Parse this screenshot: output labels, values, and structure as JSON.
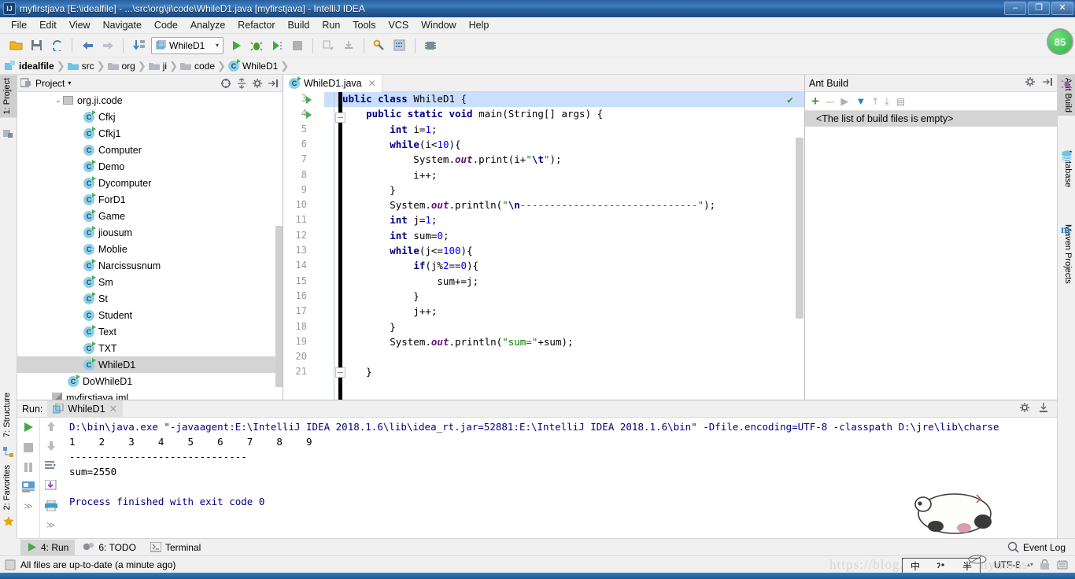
{
  "window": {
    "title": "myfirstjava [E:\\idealfile] - ...\\src\\org\\ji\\code\\WhileD1.java [myfirstjava] - IntelliJ IDEA",
    "app_icon": "intellij-logo-icon",
    "minimize": "–",
    "maximize": "❐",
    "close": "✕",
    "notification_badge": "85"
  },
  "menubar": {
    "items": [
      {
        "label": "File"
      },
      {
        "label": "Edit"
      },
      {
        "label": "View"
      },
      {
        "label": "Navigate"
      },
      {
        "label": "Code"
      },
      {
        "label": "Analyze"
      },
      {
        "label": "Refactor"
      },
      {
        "label": "Build"
      },
      {
        "label": "Run"
      },
      {
        "label": "Tools"
      },
      {
        "label": "VCS"
      },
      {
        "label": "Window"
      },
      {
        "label": "Help"
      }
    ]
  },
  "toolbar": {
    "icons": [
      {
        "name": "open-folder-icon"
      },
      {
        "name": "save-all-icon"
      },
      {
        "name": "sync-refresh-icon"
      },
      {
        "name": "back-arrow-icon"
      },
      {
        "name": "forward-arrow-icon"
      },
      {
        "name": "compile-icon"
      }
    ],
    "run_config": "WhileD1",
    "run_config_chevron": "▾",
    "right_icons": [
      {
        "name": "run-icon"
      },
      {
        "name": "debug-icon"
      },
      {
        "name": "run-coverage-icon"
      },
      {
        "name": "stop-icon"
      },
      {
        "name": "attach-profiler-icon"
      },
      {
        "name": "attach-debugger-icon"
      },
      {
        "name": "settings-wrench-icon"
      },
      {
        "name": "project-structure-icon"
      },
      {
        "name": "sdk-manager-icon"
      }
    ]
  },
  "breadcrumb": {
    "items": [
      {
        "label": "idealfile",
        "icon": "module-icon"
      },
      {
        "label": "src",
        "icon": "source-folder-icon"
      },
      {
        "label": "org",
        "icon": "folder-icon"
      },
      {
        "label": "ji",
        "icon": "folder-icon"
      },
      {
        "label": "code",
        "icon": "folder-icon"
      },
      {
        "label": "WhileD1",
        "icon": "class-icon"
      }
    ],
    "separator": "❯"
  },
  "left_strip": {
    "tabs": [
      {
        "label": "1: Project",
        "active": true,
        "icon": "project-icon"
      },
      {
        "label": "7: Structure",
        "active": false,
        "icon": "structure-icon"
      },
      {
        "label": "2: Favorites",
        "active": false,
        "icon": "star-icon"
      }
    ]
  },
  "right_strip": {
    "tabs": [
      {
        "label": "Ant Build",
        "active": true,
        "icon": "ant-icon"
      },
      {
        "label": "Database",
        "active": false,
        "icon": "database-icon"
      },
      {
        "label": "Maven Projects",
        "active": false,
        "icon": "maven-icon"
      }
    ]
  },
  "project_panel": {
    "title": "Project",
    "title_chevron": "▾",
    "header_icons": [
      {
        "name": "collapse-target-icon"
      },
      {
        "name": "expand-collapse-icon"
      },
      {
        "name": "gear-icon"
      },
      {
        "name": "hide-panel-icon"
      }
    ],
    "tree": [
      {
        "label": "org.ji.code",
        "icon": "package-icon",
        "indent": 0,
        "expanded": true,
        "selected": false
      },
      {
        "label": "Cfkj",
        "icon": "class-runnable-icon",
        "indent": 1,
        "selected": false
      },
      {
        "label": "Cfkj1",
        "icon": "class-runnable-icon",
        "indent": 1,
        "selected": false
      },
      {
        "label": "Computer",
        "icon": "class-icon",
        "indent": 1,
        "selected": false
      },
      {
        "label": "Demo",
        "icon": "class-runnable-icon",
        "indent": 1,
        "selected": false
      },
      {
        "label": "Dycomputer",
        "icon": "class-runnable-icon",
        "indent": 1,
        "selected": false
      },
      {
        "label": "ForD1",
        "icon": "class-runnable-icon",
        "indent": 1,
        "selected": false
      },
      {
        "label": "Game",
        "icon": "class-runnable-icon",
        "indent": 1,
        "selected": false
      },
      {
        "label": "jiousum",
        "icon": "class-runnable-icon",
        "indent": 1,
        "selected": false
      },
      {
        "label": "Moblie",
        "icon": "class-icon",
        "indent": 1,
        "selected": false
      },
      {
        "label": "Narcissusnum",
        "icon": "class-runnable-icon",
        "indent": 1,
        "selected": false
      },
      {
        "label": "Sm",
        "icon": "class-runnable-icon",
        "indent": 1,
        "selected": false
      },
      {
        "label": "St",
        "icon": "class-runnable-icon",
        "indent": 1,
        "selected": false
      },
      {
        "label": "Student",
        "icon": "class-icon",
        "indent": 1,
        "selected": false
      },
      {
        "label": "Text",
        "icon": "class-runnable-icon",
        "indent": 1,
        "selected": false
      },
      {
        "label": "TXT",
        "icon": "class-runnable-icon",
        "indent": 1,
        "selected": false
      },
      {
        "label": "WhileD1",
        "icon": "class-runnable-icon",
        "indent": 1,
        "selected": true
      },
      {
        "label": "DoWhileD1",
        "icon": "class-runnable-icon",
        "indent": 0,
        "selected": false
      },
      {
        "label": "myfirstjava.iml",
        "icon": "iml-file-icon",
        "indent": 0,
        "selected": false
      }
    ]
  },
  "editor": {
    "tab": {
      "label": "WhileD1.java",
      "icon": "class-icon",
      "close": "✕"
    },
    "inspection_status": "✔",
    "first_line_number": 3,
    "lines": [
      {
        "n": 3,
        "runnable": true,
        "fold": false,
        "highlight": true,
        "tokens": [
          {
            "t": "ublic ",
            "c": "kw"
          },
          {
            "t": "class ",
            "c": "kw"
          },
          {
            "t": "WhileD1 {",
            "c": ""
          }
        ]
      },
      {
        "n": 4,
        "runnable": true,
        "fold": true,
        "highlight": false,
        "tokens": [
          {
            "t": "    ",
            "c": ""
          },
          {
            "t": "public static void ",
            "c": "kw"
          },
          {
            "t": "main(String[] args) {",
            "c": ""
          }
        ]
      },
      {
        "n": 5,
        "runnable": false,
        "fold": false,
        "highlight": false,
        "tokens": [
          {
            "t": "        ",
            "c": ""
          },
          {
            "t": "int ",
            "c": "kw"
          },
          {
            "t": "i=",
            "c": ""
          },
          {
            "t": "1",
            "c": "num"
          },
          {
            "t": ";",
            "c": ""
          }
        ]
      },
      {
        "n": 6,
        "runnable": false,
        "fold": false,
        "highlight": false,
        "tokens": [
          {
            "t": "        ",
            "c": ""
          },
          {
            "t": "while",
            "c": "kw"
          },
          {
            "t": "(i<",
            "c": ""
          },
          {
            "t": "10",
            "c": "num"
          },
          {
            "t": "){",
            "c": ""
          }
        ]
      },
      {
        "n": 7,
        "runnable": false,
        "fold": false,
        "highlight": false,
        "tokens": [
          {
            "t": "            System.",
            "c": ""
          },
          {
            "t": "out",
            "c": "stc"
          },
          {
            "t": ".print(i+",
            "c": ""
          },
          {
            "t": "\"",
            "c": "str"
          },
          {
            "t": "\\t",
            "c": "esc"
          },
          {
            "t": "\"",
            "c": "str"
          },
          {
            "t": ");",
            "c": ""
          }
        ]
      },
      {
        "n": 8,
        "runnable": false,
        "fold": false,
        "highlight": false,
        "tokens": [
          {
            "t": "            i++;",
            "c": ""
          }
        ]
      },
      {
        "n": 9,
        "runnable": false,
        "fold": false,
        "highlight": false,
        "tokens": [
          {
            "t": "        }",
            "c": ""
          }
        ]
      },
      {
        "n": 10,
        "runnable": false,
        "fold": false,
        "highlight": false,
        "tokens": [
          {
            "t": "        System.",
            "c": ""
          },
          {
            "t": "out",
            "c": "stc"
          },
          {
            "t": ".println(",
            "c": ""
          },
          {
            "t": "\"",
            "c": "str"
          },
          {
            "t": "\\n",
            "c": "esc"
          },
          {
            "t": "------------------------------",
            "c": "str"
          },
          {
            "t": "\"",
            "c": "str"
          },
          {
            "t": ");",
            "c": ""
          }
        ]
      },
      {
        "n": 11,
        "runnable": false,
        "fold": false,
        "highlight": false,
        "tokens": [
          {
            "t": "        ",
            "c": ""
          },
          {
            "t": "int ",
            "c": "kw"
          },
          {
            "t": "j=",
            "c": ""
          },
          {
            "t": "1",
            "c": "num"
          },
          {
            "t": ";",
            "c": ""
          }
        ]
      },
      {
        "n": 12,
        "runnable": false,
        "fold": false,
        "highlight": false,
        "tokens": [
          {
            "t": "        ",
            "c": ""
          },
          {
            "t": "int ",
            "c": "kw"
          },
          {
            "t": "sum=",
            "c": ""
          },
          {
            "t": "0",
            "c": "num"
          },
          {
            "t": ";",
            "c": ""
          }
        ]
      },
      {
        "n": 13,
        "runnable": false,
        "fold": false,
        "highlight": false,
        "tokens": [
          {
            "t": "        ",
            "c": ""
          },
          {
            "t": "while",
            "c": "kw"
          },
          {
            "t": "(j<=",
            "c": ""
          },
          {
            "t": "100",
            "c": "num"
          },
          {
            "t": "){",
            "c": ""
          }
        ]
      },
      {
        "n": 14,
        "runnable": false,
        "fold": false,
        "highlight": false,
        "tokens": [
          {
            "t": "            ",
            "c": ""
          },
          {
            "t": "if",
            "c": "kw"
          },
          {
            "t": "(j%",
            "c": ""
          },
          {
            "t": "2",
            "c": "num"
          },
          {
            "t": "==",
            "c": ""
          },
          {
            "t": "0",
            "c": "num"
          },
          {
            "t": "){",
            "c": ""
          }
        ]
      },
      {
        "n": 15,
        "runnable": false,
        "fold": false,
        "highlight": false,
        "tokens": [
          {
            "t": "                sum+=j;",
            "c": ""
          }
        ]
      },
      {
        "n": 16,
        "runnable": false,
        "fold": false,
        "highlight": false,
        "tokens": [
          {
            "t": "            }",
            "c": ""
          }
        ]
      },
      {
        "n": 17,
        "runnable": false,
        "fold": false,
        "highlight": false,
        "tokens": [
          {
            "t": "            j++;",
            "c": ""
          }
        ]
      },
      {
        "n": 18,
        "runnable": false,
        "fold": false,
        "highlight": false,
        "tokens": [
          {
            "t": "        }",
            "c": ""
          }
        ]
      },
      {
        "n": 19,
        "runnable": false,
        "fold": false,
        "highlight": false,
        "tokens": [
          {
            "t": "        System.",
            "c": ""
          },
          {
            "t": "out",
            "c": "stc"
          },
          {
            "t": ".println(",
            "c": ""
          },
          {
            "t": "\"sum=\"",
            "c": "str"
          },
          {
            "t": "+sum);",
            "c": ""
          }
        ]
      },
      {
        "n": 20,
        "runnable": false,
        "fold": false,
        "highlight": false,
        "tokens": [
          {
            "t": "",
            "c": ""
          }
        ]
      },
      {
        "n": 21,
        "runnable": false,
        "fold": true,
        "highlight": false,
        "tokens": [
          {
            "t": "    }",
            "c": ""
          }
        ]
      }
    ]
  },
  "ant_panel": {
    "title": "Ant Build",
    "empty_message": "<The list of build files is empty>",
    "toolbar_icons": [
      {
        "name": "add-icon",
        "glyph": "+"
      },
      {
        "name": "remove-icon",
        "glyph": "–"
      },
      {
        "name": "run-build-icon",
        "glyph": "▶"
      },
      {
        "name": "filter-icon",
        "glyph": "▼"
      },
      {
        "name": "expand-all-icon",
        "glyph": "⤒"
      },
      {
        "name": "collapse-all-icon",
        "glyph": "⤓"
      },
      {
        "name": "properties-icon",
        "glyph": "▤"
      }
    ],
    "header_icons": [
      {
        "name": "gear-icon"
      },
      {
        "name": "hide-panel-icon"
      }
    ]
  },
  "run_panel": {
    "label": "Run:",
    "tab": {
      "label": "WhileD1",
      "icon": "run-config-icon",
      "close": "✕"
    },
    "left_icons": [
      {
        "name": "rerun-icon"
      },
      {
        "name": "stop-icon"
      },
      {
        "name": "pause-icon"
      },
      {
        "name": "console-view-icon"
      },
      {
        "name": "more-icon"
      }
    ],
    "right_icons": [
      {
        "name": "scroll-up-icon"
      },
      {
        "name": "scroll-down-icon"
      },
      {
        "name": "soft-wrap-icon"
      },
      {
        "name": "scroll-to-end-icon"
      },
      {
        "name": "print-icon"
      },
      {
        "name": "more-icon"
      }
    ],
    "header_icons": [
      {
        "name": "gear-icon"
      },
      {
        "name": "hide-panel-icon"
      }
    ],
    "console_lines": [
      {
        "text": "D:\\bin\\java.exe \"-javaagent:E:\\IntelliJ IDEA 2018.1.6\\lib\\idea_rt.jar=52881:E:\\IntelliJ IDEA 2018.1.6\\bin\" -Dfile.encoding=UTF-8 -classpath D:\\jre\\lib\\charse",
        "style": "link"
      },
      {
        "text": "1\t2\t3\t4\t5\t6\t7\t8\t9\t",
        "style": "plain"
      },
      {
        "text": "------------------------------",
        "style": "plain"
      },
      {
        "text": "sum=2550",
        "style": "plain"
      },
      {
        "text": "",
        "style": "plain"
      },
      {
        "text": "Process finished with exit code 0",
        "style": "link"
      }
    ]
  },
  "bottom_tabs": {
    "items": [
      {
        "label": "4: Run",
        "active": true,
        "icon": "run-icon"
      },
      {
        "label": "6: TODO",
        "active": false,
        "icon": "todo-icon"
      },
      {
        "label": "Terminal",
        "active": false,
        "icon": "terminal-icon"
      }
    ],
    "event_log": {
      "label": "Event Log",
      "icon": "event-log-icon"
    }
  },
  "status_bar": {
    "message": "All files are up-to-date (a minute ago)",
    "message_icon": "build-status-icon",
    "encoding": "UTF-8",
    "encoding_chevron": "▴▾",
    "lock_icon": "lock-icon",
    "memory_icon": "memory-icon",
    "watermark": "https://blog.csdn.net/anonymous",
    "ime": {
      "lang": "中",
      "punct": "",
      "shape": "半",
      "pen_icon": "pen-icon"
    }
  },
  "colors": {
    "title_bar": "#2a5f9e",
    "accent_green": "#4caf50",
    "keyword_blue": "#000080",
    "string_green": "#008000",
    "number_blue": "#0000ff",
    "static_purple": "#660e7a",
    "selection_gray": "#d4d4d4",
    "highlight_blue": "#c9dffb",
    "console_link": "#000080"
  }
}
